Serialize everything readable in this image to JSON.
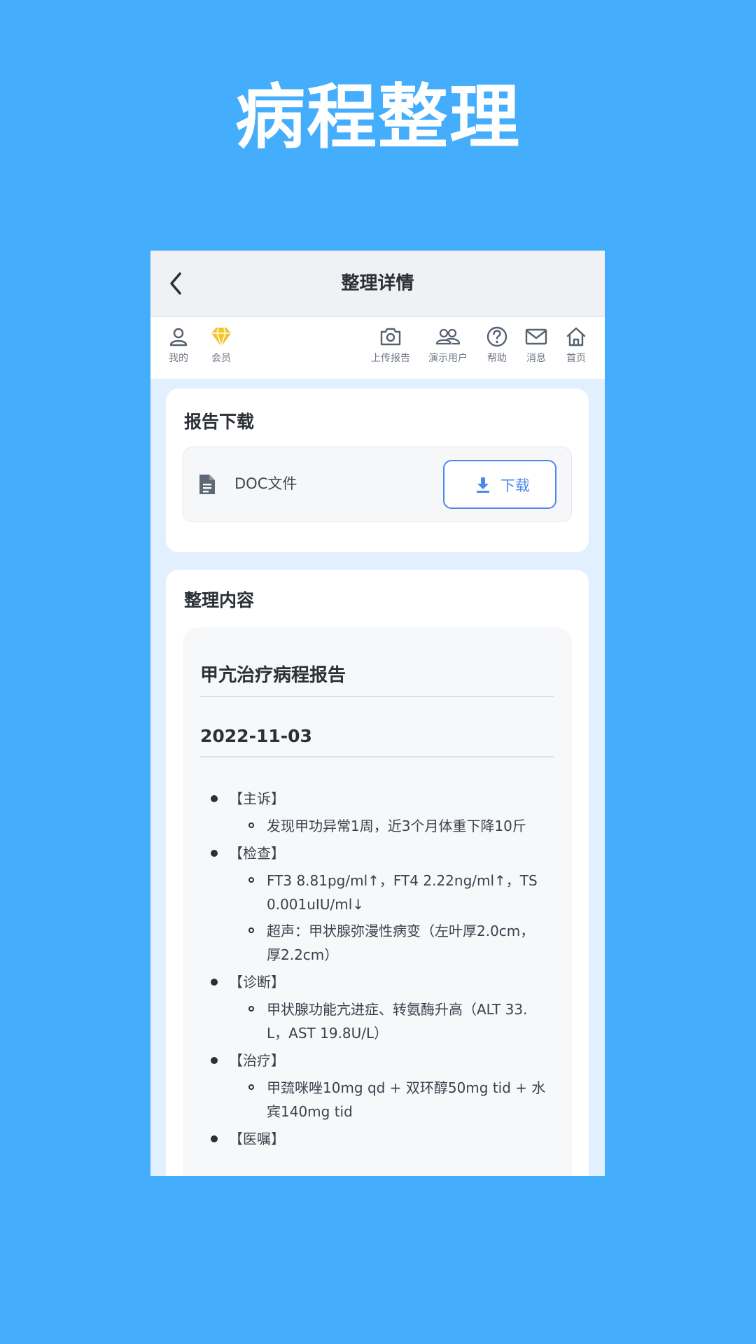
{
  "promo": {
    "headline": "病程整理"
  },
  "nav": {
    "title": "整理详情"
  },
  "toolbar": {
    "items": [
      {
        "label": "我的",
        "icon": "user-icon"
      },
      {
        "label": "会员",
        "icon": "diamond-icon",
        "color": "#f6c626"
      },
      {
        "label": "上传报告",
        "icon": "camera-icon"
      },
      {
        "label": "演示用户",
        "icon": "users-icon"
      },
      {
        "label": "帮助",
        "icon": "help-icon"
      },
      {
        "label": "消息",
        "icon": "mail-icon"
      },
      {
        "label": "首页",
        "icon": "home-icon"
      }
    ]
  },
  "download_card": {
    "title": "报告下载",
    "file_label": "DOC文件",
    "button_label": "下载"
  },
  "content_card": {
    "title": "整理内容",
    "report_title": "甲亢治疗病程报告",
    "date": "2022-11-03",
    "sections": [
      {
        "label": "【主诉】",
        "items": [
          [
            "发现甲功异常1周，近3个月体重下降10斤"
          ]
        ]
      },
      {
        "label": "【检查】",
        "items": [
          [
            "FT3 8.81pg/ml↑，FT4 2.22ng/ml↑，TS",
            "0.001uIU/ml↓"
          ],
          [
            "超声：甲状腺弥漫性病变（左叶厚2.0cm，",
            "厚2.2cm）"
          ]
        ]
      },
      {
        "label": "【诊断】",
        "items": [
          [
            "甲状腺功能亢进症、转氨酶升高（ALT 33.",
            "L，AST 19.8U/L）"
          ]
        ]
      },
      {
        "label": "【治疗】",
        "items": [
          [
            "甲巯咪唑10mg qd + 双环醇50mg tid + 水",
            "宾140mg tid"
          ]
        ]
      },
      {
        "label": "【医嘱】",
        "items": []
      }
    ]
  },
  "colors": {
    "background": "#44adfc",
    "accent": "#4c87ea",
    "vip": "#f6c626"
  }
}
